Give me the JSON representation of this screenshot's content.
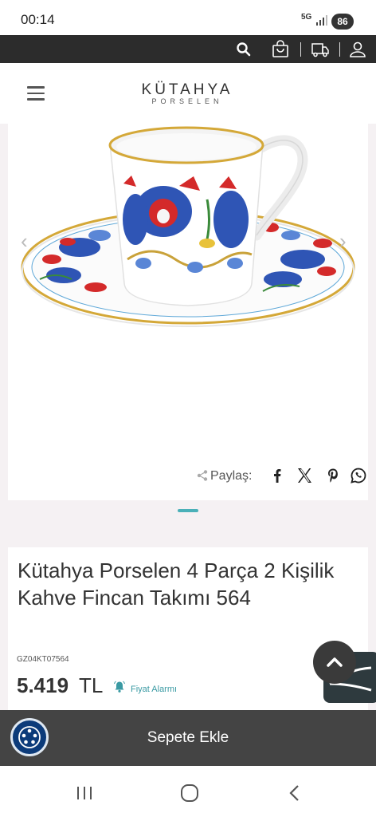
{
  "status_bar": {
    "time": "00:14",
    "network": "5G",
    "battery": "86"
  },
  "toolbar": {
    "icons": [
      "search-icon",
      "shopping-bag-icon",
      "delivery-truck-icon",
      "user-icon"
    ]
  },
  "header": {
    "logo_main": "KÜTAHYA",
    "logo_sub": "PORSELEN"
  },
  "gallery": {
    "image_alt": "Kütahya Porselen coffee cup and saucer with red tulips and blue flowers",
    "share_label": "Paylaş:",
    "share_icons": [
      "facebook-icon",
      "x-icon",
      "pinterest-icon",
      "whatsapp-icon"
    ]
  },
  "product": {
    "title": "Kütahya Porselen 4 Parça 2 Kişilik Kahve Fincan Takımı 564",
    "code": "GZ04KT07564",
    "price": "5.419",
    "currency": "TL",
    "price_alert_label": "Fiyat Alarmı"
  },
  "cart": {
    "add_to_cart_label": "Sepete Ekle"
  },
  "colors": {
    "toolbar_bg": "#2c2c2c",
    "accent": "#4ab0b8",
    "cart_bar_bg": "#444444"
  }
}
